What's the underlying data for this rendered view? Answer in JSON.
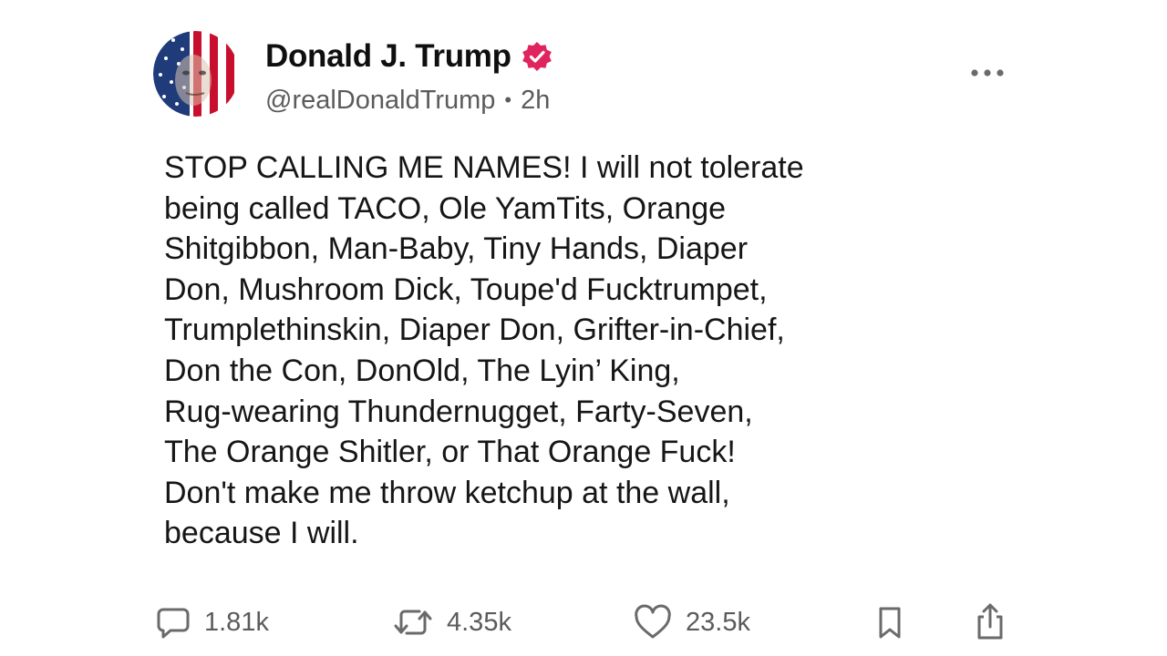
{
  "author": {
    "display_name": "Donald J. Trump",
    "handle": "@realDonaldTrump",
    "separator": "•",
    "time_ago": "2h",
    "verified": true,
    "verified_color": "#e0245e"
  },
  "post": {
    "text": "STOP CALLING ME NAMES! I will not tolerate\nbeing called TACO, Ole YamTits, Orange\nShitgibbon, Man-Baby, Tiny Hands, Diaper\nDon, Mushroom Dick, Toupe'd Fucktrumpet,\nTrumplethinskin, Diaper Don, Grifter-in-Chief,\nDon the Con, DonOld, The Lyin’ King,\nRug-wearing Thundernugget, Farty-Seven,\nThe Orange Shitler, or That Orange Fuck!\nDon't make me throw ketchup at the wall,\nbecause I will."
  },
  "actions": {
    "replies": "1.81k",
    "reposts": "4.35k",
    "likes": "23.5k"
  },
  "icons": {
    "avatar": "flag-face-avatar",
    "verified": "verified-badge-icon",
    "more": "more-options-icon",
    "reply": "reply-bubble-icon",
    "repost": "repost-arrows-icon",
    "like": "heart-icon",
    "bookmark": "bookmark-icon",
    "share": "share-icon"
  },
  "colors": {
    "text": "#161616",
    "muted": "#5b5b5b",
    "icon": "#6a6a6a"
  }
}
